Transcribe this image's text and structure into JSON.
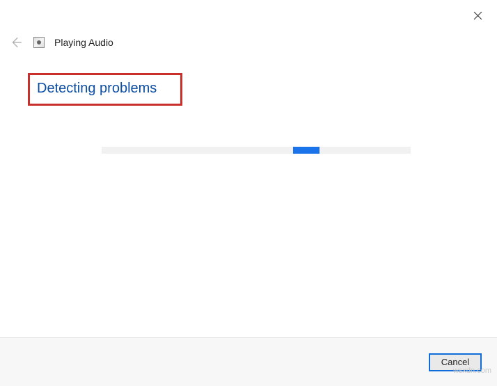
{
  "window": {
    "title": "Playing Audio"
  },
  "content": {
    "heading": "Detecting problems"
  },
  "footer": {
    "cancel_label": "Cancel"
  },
  "watermark": "wsxdn.com",
  "colors": {
    "accent": "#1a73e8",
    "heading": "#0b4da2",
    "highlight_border": "#c9302c"
  },
  "progress": {
    "indeterminate": true,
    "chunk_left_pct": 62
  }
}
